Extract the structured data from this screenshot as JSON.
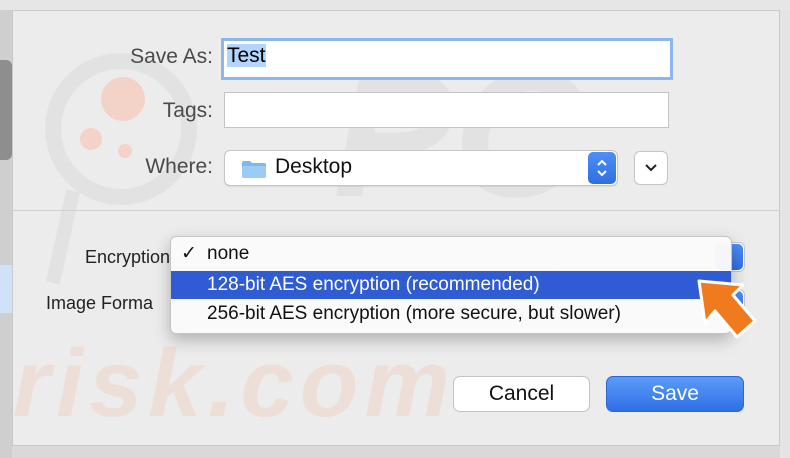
{
  "form": {
    "save_as_label": "Save As:",
    "save_as_value": "Test",
    "tags_label": "Tags:",
    "tags_value": "",
    "where_label": "Where:",
    "where_value": "Desktop",
    "encryption_label": "Encryption",
    "image_format_label": "Image Forma"
  },
  "encryption_menu": {
    "items": [
      {
        "label": "none",
        "checked": true,
        "highlighted": false
      },
      {
        "label": "128-bit AES encryption (recommended)",
        "checked": false,
        "highlighted": true
      },
      {
        "label": "256-bit AES encryption (more secure, but slower)",
        "checked": false,
        "highlighted": false
      }
    ],
    "check_glyph": "✓"
  },
  "buttons": {
    "cancel": "Cancel",
    "save": "Save"
  },
  "icons": {
    "folder": "folder-icon",
    "stepper": "up-down-chevron-icon",
    "expand": "chevron-down-icon",
    "annotation": "orange-arrow-icon"
  },
  "watermark": {
    "top": "PC",
    "bottom": "risk.com"
  },
  "colors": {
    "accent": "#2f6fe0",
    "menu_highlight": "#2f5bd3",
    "arrow": "#f07a1e",
    "focus_ring": "#8bb6ee"
  }
}
